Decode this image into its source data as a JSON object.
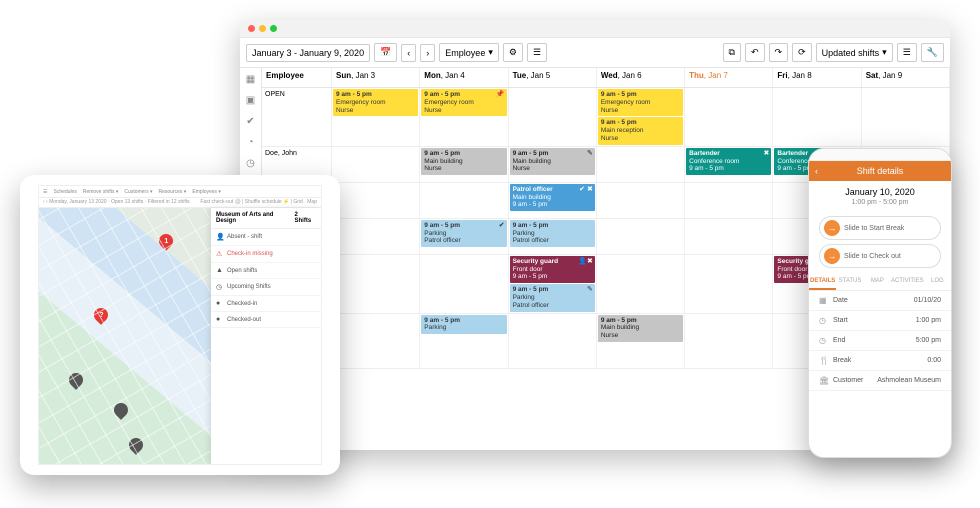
{
  "desktop": {
    "date_range": "January 3 - January 9, 2020",
    "group_by": "Employee",
    "filter": "Updated shifts",
    "employee_header": "Employee",
    "days": [
      {
        "dow": "Sun",
        "d": "Jan 3"
      },
      {
        "dow": "Mon",
        "d": "Jan 4"
      },
      {
        "dow": "Tue",
        "d": "Jan 5"
      },
      {
        "dow": "Wed",
        "d": "Jan 6"
      },
      {
        "dow": "Thu",
        "d": "Jan 7"
      },
      {
        "dow": "Fri",
        "d": "Jan 8"
      },
      {
        "dow": "Sat",
        "d": "Jan 9"
      }
    ],
    "rows": {
      "open": {
        "label": "OPEN"
      },
      "doe": {
        "label": "Doe, John"
      }
    },
    "shifts": {
      "er_time": "9 am - 5 pm",
      "er_loc": "Emergency room",
      "er_role": "Nurse",
      "mr_loc": "Main reception",
      "mb_loc": "Main building",
      "po": "Patrol officer",
      "po_sub": "9 am - 5 pm",
      "pk": "Parking",
      "sg": "Security guard",
      "fd": "Front door",
      "bt": "Bartender",
      "cr": "Conference room",
      "cr_sub": "9 am - 5 pm"
    }
  },
  "tablet": {
    "top_date": "Monday, January 13 2020",
    "panel_title": "Museum of Arts and Design",
    "panel_count": "2 Shifts",
    "items": {
      "absent": "Absent - shift",
      "alert": "Check-in missing",
      "open": "Open shifts",
      "upcoming": "Upcoming Shifts",
      "checkin": "Checked-in",
      "checkout": "Checked-out"
    }
  },
  "phone": {
    "title": "Shift details",
    "date": "January 10, 2020",
    "time": "1:00 pm - 5:00 pm",
    "slide1": "Slide to Start Break",
    "slide2": "Slide to Check out",
    "tabs": {
      "details": "DETAILS",
      "status": "STATUS",
      "map": "MAP",
      "act": "ACTIVITIES",
      "log": "LOG"
    },
    "rows": {
      "date_l": "Date",
      "date_v": "01/10/20",
      "start_l": "Start",
      "start_v": "1:00 pm",
      "end_l": "End",
      "end_v": "5:00 pm",
      "break_l": "Break",
      "break_v": "0:00",
      "cust_l": "Customer",
      "cust_v": "Ashmolean Museum"
    }
  }
}
